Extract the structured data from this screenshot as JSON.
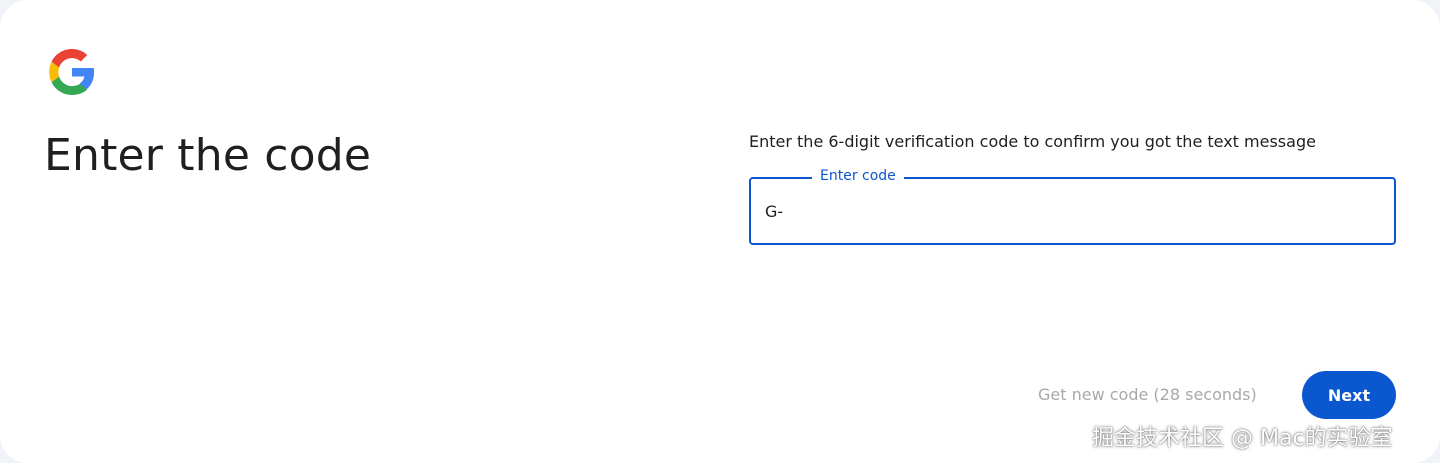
{
  "logo": {
    "icon": "google-g-icon",
    "colors": [
      "#4285f4",
      "#ea4335",
      "#fbbc05",
      "#34a853"
    ]
  },
  "page": {
    "title": "Enter the code"
  },
  "form": {
    "instructions": "Enter the 6-digit verification code to confirm you got the text message",
    "code_label": "Enter code",
    "code_value": "G-"
  },
  "actions": {
    "resend_label": "Get new code (28 seconds)",
    "next_label": "Next"
  },
  "watermark": {
    "text": "掘金技术社区 @ Mac的实验室"
  },
  "colors": {
    "accent": "#0b57d0",
    "disabled_text": "#a8a8a8",
    "text": "#1f1f1f"
  }
}
